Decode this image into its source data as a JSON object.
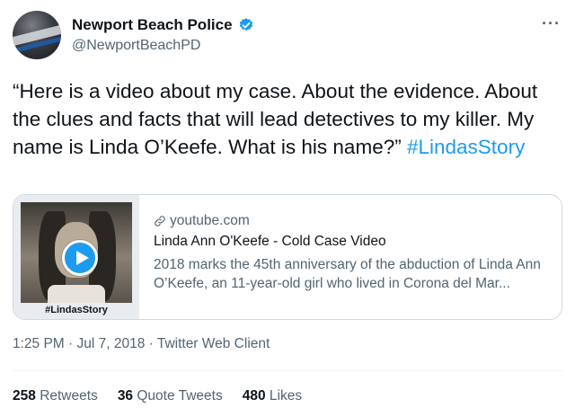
{
  "author": {
    "display_name": "Newport Beach Police",
    "handle": "@NewportBeachPD"
  },
  "more_glyph": "···",
  "tweet": {
    "text": "“Here is a video about my case. About the evidence. About the clues and facts that will lead detectives to my killer. My name is Linda O’Keefe. What is his name?”",
    "hashtag": "#LindasStory"
  },
  "card": {
    "thumb_tag": "#LindasStory",
    "domain": "youtube.com",
    "title": "Linda Ann O'Keefe - Cold Case Video",
    "description": "2018 marks the 45th anniversary of the abduction of Linda Ann O’Keefe, an 11-year-old girl who lived in Corona del Mar..."
  },
  "meta": "1:25 PM · Jul 7, 2018 · Twitter Web Client",
  "stats": [
    {
      "num": "258",
      "label": "Retweets"
    },
    {
      "num": "36",
      "label": "Quote Tweets"
    },
    {
      "num": "480",
      "label": "Likes"
    }
  ],
  "colors": {
    "accent": "#1d9bf0",
    "text": "#0f1419",
    "secondary": "#536471",
    "border": "#cfd9de"
  },
  "icons": [
    "verified-badge-icon",
    "more-icon",
    "link-icon",
    "play-icon"
  ]
}
